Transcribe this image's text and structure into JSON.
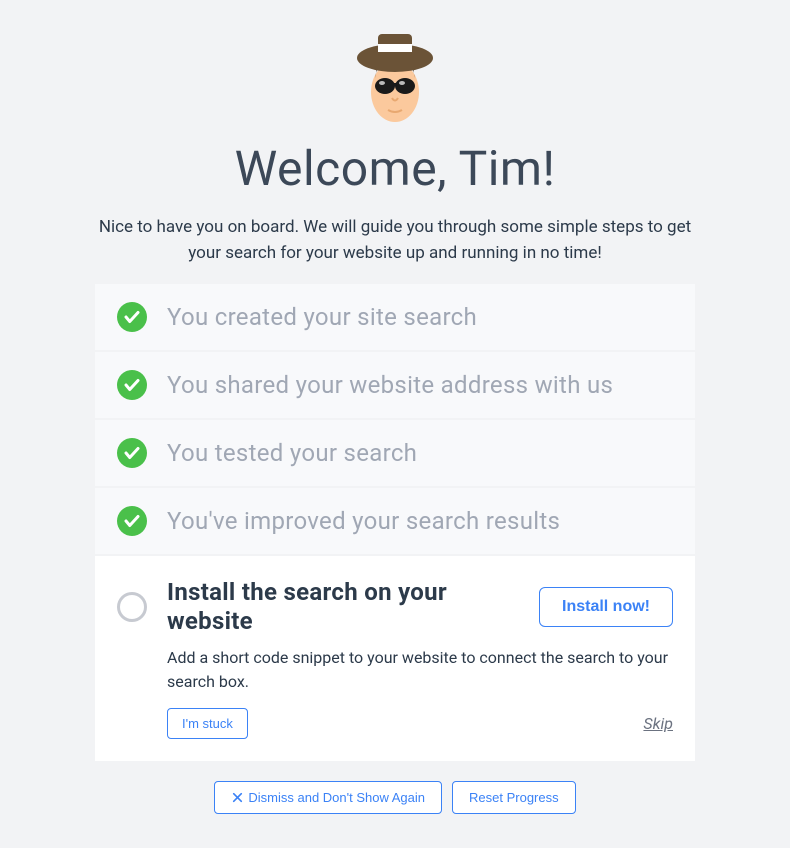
{
  "welcome": {
    "title": "Welcome, Tim!",
    "subtitle": "Nice to have you on board. We will guide you through some simple steps to get your search for your website up and running in no time!"
  },
  "steps": [
    {
      "status": "done",
      "title": "You created your site search"
    },
    {
      "status": "done",
      "title": "You shared your website address with us"
    },
    {
      "status": "done",
      "title": "You tested your search"
    },
    {
      "status": "done",
      "title": "You've improved your search results"
    },
    {
      "status": "pending",
      "title": "Install the search on your website",
      "description": "Add a short code snippet to your website to connect the search to your search box.",
      "cta": "Install now!",
      "stuck": "I'm stuck",
      "skip": "Skip"
    }
  ],
  "footer": {
    "dismiss": "Dismiss and Don't Show Again",
    "reset": "Reset Progress"
  },
  "colors": {
    "success": "#4ac04a",
    "primary": "#3b82f6",
    "text": "#2c3a4a",
    "muted": "#a0a7b4"
  }
}
